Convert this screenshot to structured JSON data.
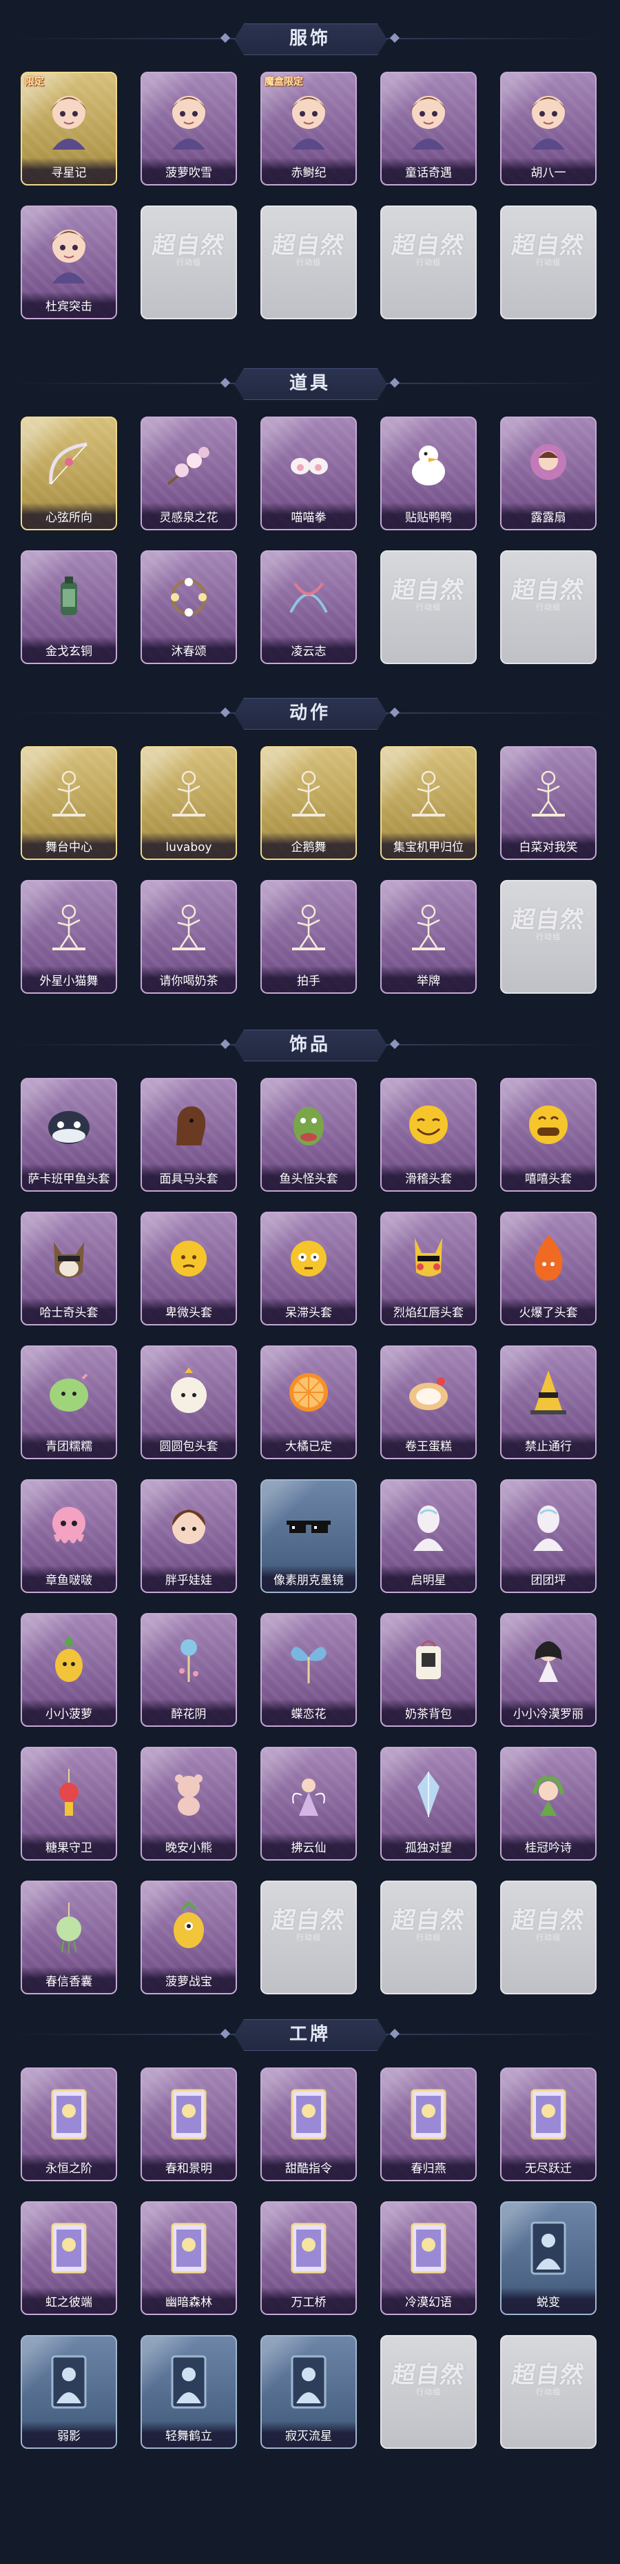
{
  "sections": [
    {
      "title": "服饰",
      "items": [
        {
          "label": "寻星记",
          "tier": "gold",
          "icon": "character-portrait-icon",
          "badge": "限定"
        },
        {
          "label": "菠萝吹雪",
          "tier": "purple",
          "icon": "character-portrait-icon",
          "badge": ""
        },
        {
          "label": "赤鲥纪",
          "tier": "purple",
          "icon": "character-portrait-icon",
          "badge": "魔盒限定"
        },
        {
          "label": "童话奇遇",
          "tier": "purple",
          "icon": "character-portrait-icon",
          "badge": ""
        },
        {
          "label": "胡八一",
          "tier": "purple",
          "icon": "character-portrait-icon",
          "badge": ""
        },
        {
          "label": "杜宾突击",
          "tier": "purple",
          "icon": "character-portrait-icon",
          "badge": ""
        },
        {
          "label": "",
          "tier": "empty"
        },
        {
          "label": "",
          "tier": "empty"
        },
        {
          "label": "",
          "tier": "empty"
        },
        {
          "label": "",
          "tier": "empty"
        }
      ]
    },
    {
      "title": "道具",
      "items": [
        {
          "label": "心弦所向",
          "tier": "gold",
          "icon": "bow-icon",
          "badge": ""
        },
        {
          "label": "灵感泉之花",
          "tier": "purple",
          "icon": "flower-branch-icon",
          "badge": ""
        },
        {
          "label": "喵喵拳",
          "tier": "purple",
          "icon": "cat-paw-icon",
          "badge": ""
        },
        {
          "label": "贴贴鸭鸭",
          "tier": "purple",
          "icon": "duck-icon",
          "badge": ""
        },
        {
          "label": "露露扇",
          "tier": "purple",
          "icon": "doll-fan-icon",
          "badge": ""
        },
        {
          "label": "金戈玄铜",
          "tier": "purple",
          "icon": "lantern-icon",
          "badge": ""
        },
        {
          "label": "沐春颂",
          "tier": "purple",
          "icon": "flower-wreath-icon",
          "badge": ""
        },
        {
          "label": "凌云志",
          "tier": "purple",
          "icon": "ribbon-icon",
          "badge": ""
        },
        {
          "label": "",
          "tier": "empty"
        },
        {
          "label": "",
          "tier": "empty"
        }
      ]
    },
    {
      "title": "动作",
      "items": [
        {
          "label": "舞台中心",
          "tier": "gold",
          "icon": "pose-figure-icon",
          "badge": ""
        },
        {
          "label": "luvaboy",
          "tier": "gold",
          "icon": "pose-figure-icon",
          "badge": ""
        },
        {
          "label": "企鹅舞",
          "tier": "gold",
          "icon": "pose-figure-icon",
          "badge": ""
        },
        {
          "label": "集宝机甲归位",
          "tier": "gold",
          "icon": "pose-figure-icon",
          "badge": ""
        },
        {
          "label": "白菜对我笑",
          "tier": "purple",
          "icon": "pose-figure-icon",
          "badge": ""
        },
        {
          "label": "外星小猫舞",
          "tier": "purple",
          "icon": "pose-figure-icon",
          "badge": ""
        },
        {
          "label": "请你喝奶茶",
          "tier": "purple",
          "icon": "pose-figure-icon",
          "badge": ""
        },
        {
          "label": "拍手",
          "tier": "purple",
          "icon": "pose-figure-icon",
          "badge": ""
        },
        {
          "label": "举牌",
          "tier": "purple",
          "icon": "pose-figure-icon",
          "badge": ""
        },
        {
          "label": "",
          "tier": "empty"
        }
      ]
    },
    {
      "title": "饰品",
      "items": [
        {
          "label": "萨卡班甲鱼头套",
          "tier": "purple",
          "icon": "fish-head-icon"
        },
        {
          "label": "面具马头套",
          "tier": "purple",
          "icon": "horse-head-icon"
        },
        {
          "label": "鱼头怪头套",
          "tier": "purple",
          "icon": "fish-monster-head-icon"
        },
        {
          "label": "滑稽头套",
          "tier": "purple",
          "icon": "smiley-head-icon"
        },
        {
          "label": "嘻嘻头套",
          "tier": "purple",
          "icon": "grin-head-icon"
        },
        {
          "label": "哈士奇头套",
          "tier": "purple",
          "icon": "dog-head-icon"
        },
        {
          "label": "卑微头套",
          "tier": "purple",
          "icon": "sad-face-head-icon"
        },
        {
          "label": "呆滞头套",
          "tier": "purple",
          "icon": "dazed-face-head-icon"
        },
        {
          "label": "烈焰红唇头套",
          "tier": "purple",
          "icon": "pikachu-head-icon"
        },
        {
          "label": "火爆了头套",
          "tier": "purple",
          "icon": "flame-head-icon"
        },
        {
          "label": "青团糯糯",
          "tier": "purple",
          "icon": "green-bun-icon"
        },
        {
          "label": "圆圆包头套",
          "tier": "purple",
          "icon": "bun-head-icon"
        },
        {
          "label": "大橘已定",
          "tier": "purple",
          "icon": "orange-slice-icon"
        },
        {
          "label": "卷王蛋糕",
          "tier": "purple",
          "icon": "cake-roll-icon"
        },
        {
          "label": "禁止通行",
          "tier": "purple",
          "icon": "traffic-cone-icon"
        },
        {
          "label": "章鱼啵啵",
          "tier": "purple",
          "icon": "octopus-icon"
        },
        {
          "label": "胖乎娃娃",
          "tier": "purple",
          "icon": "doll-head-icon"
        },
        {
          "label": "像素朋克墨镜",
          "tier": "blue",
          "icon": "pixel-sunglasses-icon"
        },
        {
          "label": "启明星",
          "tier": "purple",
          "icon": "mannequin-icon"
        },
        {
          "label": "团团坪",
          "tier": "purple",
          "icon": "mannequin-icon"
        },
        {
          "label": "小小菠萝",
          "tier": "purple",
          "icon": "pineapple-icon"
        },
        {
          "label": "醉花阴",
          "tier": "purple",
          "icon": "hair-ornament-icon"
        },
        {
          "label": "蝶恋花",
          "tier": "purple",
          "icon": "butterfly-hairpin-icon"
        },
        {
          "label": "奶茶背包",
          "tier": "purple",
          "icon": "milk-tea-bag-icon"
        },
        {
          "label": "小小冷漠罗丽",
          "tier": "purple",
          "icon": "doll-pendant-icon"
        },
        {
          "label": "糖果守卫",
          "tier": "purple",
          "icon": "candy-pendant-icon"
        },
        {
          "label": "晚安小熊",
          "tier": "purple",
          "icon": "bear-pendant-icon"
        },
        {
          "label": "拂云仙",
          "tier": "purple",
          "icon": "fairy-pendant-icon"
        },
        {
          "label": "孤独对望",
          "tier": "purple",
          "icon": "crystal-pendant-icon"
        },
        {
          "label": "桂冠吟诗",
          "tier": "purple",
          "icon": "laurel-pendant-icon"
        },
        {
          "label": "春信香囊",
          "tier": "purple",
          "icon": "sachet-icon"
        },
        {
          "label": "菠萝战宝",
          "tier": "purple",
          "icon": "yellow-creature-icon"
        },
        {
          "label": "",
          "tier": "empty"
        },
        {
          "label": "",
          "tier": "empty"
        },
        {
          "label": "",
          "tier": "empty"
        }
      ]
    },
    {
      "title": "工牌",
      "items": [
        {
          "label": "永恒之阶",
          "tier": "purple",
          "icon": "badge-card-icon"
        },
        {
          "label": "春和景明",
          "tier": "purple",
          "icon": "badge-card-icon"
        },
        {
          "label": "甜酷指令",
          "tier": "purple",
          "icon": "badge-card-icon"
        },
        {
          "label": "春归燕",
          "tier": "purple",
          "icon": "badge-card-icon"
        },
        {
          "label": "无尽跃迁",
          "tier": "purple",
          "icon": "badge-card-icon"
        },
        {
          "label": "虹之彼端",
          "tier": "purple",
          "icon": "badge-card-icon"
        },
        {
          "label": "幽暗森林",
          "tier": "purple",
          "icon": "badge-card-icon"
        },
        {
          "label": "万工桥",
          "tier": "purple",
          "icon": "badge-card-icon"
        },
        {
          "label": "冷漠幻语",
          "tier": "purple",
          "icon": "badge-card-icon"
        },
        {
          "label": "蜕变",
          "tier": "blue",
          "icon": "silhouette-card-icon"
        },
        {
          "label": "弱影",
          "tier": "blue",
          "icon": "silhouette-card-icon"
        },
        {
          "label": "轻舞鹤立",
          "tier": "blue",
          "icon": "silhouette-card-icon"
        },
        {
          "label": "寂灭流星",
          "tier": "blue",
          "icon": "silhouette-card-icon"
        },
        {
          "label": "",
          "tier": "empty"
        },
        {
          "label": "",
          "tier": "empty"
        }
      ]
    }
  ],
  "placeholder": {
    "stamp": "超自然",
    "sub": "行动组"
  },
  "colors": {
    "background": "#131a29",
    "gold_frame": "#f1da8d",
    "purple_frame": "#c6a9d6",
    "blue_frame": "#9fb6d1",
    "empty_frame": "#e4e5e8"
  }
}
